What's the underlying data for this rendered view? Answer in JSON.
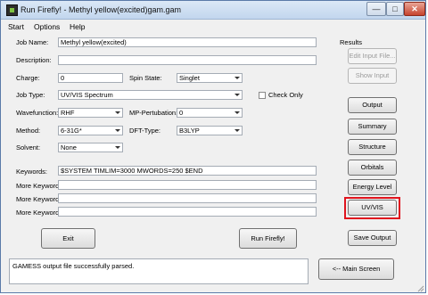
{
  "window": {
    "title": "Run Firefly! - Methyl yellow(excited)gam.gam"
  },
  "menu": [
    "Start",
    "Options",
    "Help"
  ],
  "form": {
    "job_name_label": "Job Name:",
    "job_name_value": "Methyl yellow(excited)",
    "description_label": "Description:",
    "description_value": "",
    "charge_label": "Charge:",
    "charge_value": "0",
    "spin_state_label": "Spin State:",
    "spin_state_value": "Singlet",
    "job_type_label": "Job Type:",
    "job_type_value": "UV/VIS Spectrum",
    "check_only_label": "Check Only",
    "wavefunction_label": "Wavefunction:",
    "wavefunction_value": "RHF",
    "mp_pertubation_label": "MP-Pertubation:",
    "mp_pertubation_value": "0",
    "method_label": "Method:",
    "method_value": "6-31G*",
    "dft_type_label": "DFT-Type:",
    "dft_type_value": "B3LYP",
    "solvent_label": "Solvent:",
    "solvent_value": "None",
    "keywords_label": "Keywords:",
    "keywords_value": "$SYSTEM TIMLIM=3000 MWORDS=250 $END",
    "more_keywords_label": "More Keywords",
    "more_keywords_values": [
      "",
      "",
      ""
    ]
  },
  "buttons": {
    "exit": "Exit",
    "run": "Run Firefly!",
    "main_screen": "<-- Main Screen"
  },
  "results": {
    "title": "Results",
    "edit_input": "Edit Input File...",
    "show_input": "Show Input",
    "output": "Output",
    "summary": "Summary",
    "structure": "Structure",
    "orbitals": "Orbitals",
    "energy_level": "Energy Level",
    "uv_vis": "UV/VIS",
    "save_output": "Save Output"
  },
  "status": {
    "text": "GAMESS output file successfully parsed."
  },
  "icons": {
    "app": "firefly-app-icon",
    "close": "close-icon",
    "minimize": "minimize-icon",
    "maximize": "maximize-icon"
  },
  "colors": {
    "highlight": "#e0141e"
  }
}
